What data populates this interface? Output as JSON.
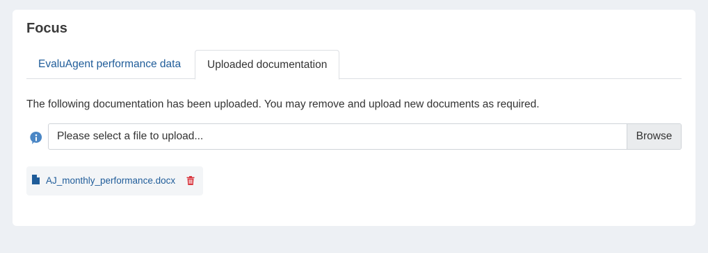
{
  "panel": {
    "title": "Focus"
  },
  "tabs": [
    {
      "label": "EvaluAgent performance data",
      "active": false
    },
    {
      "label": "Uploaded documentation",
      "active": true
    }
  ],
  "content": {
    "description": "The following documentation has been uploaded. You may remove and upload new documents as required.",
    "upload": {
      "placeholder": "Please select a file to upload...",
      "browse_label": "Browse",
      "info_icon": "info-circle-icon"
    },
    "files": [
      {
        "name": "AJ_monthly_performance.docx",
        "icon": "file-icon",
        "delete_icon": "trash-icon"
      }
    ]
  },
  "colors": {
    "link": "#1f5c99",
    "info_icon": "#4a86c5",
    "delete_icon": "#d9363e",
    "page_background": "#edf0f4"
  }
}
